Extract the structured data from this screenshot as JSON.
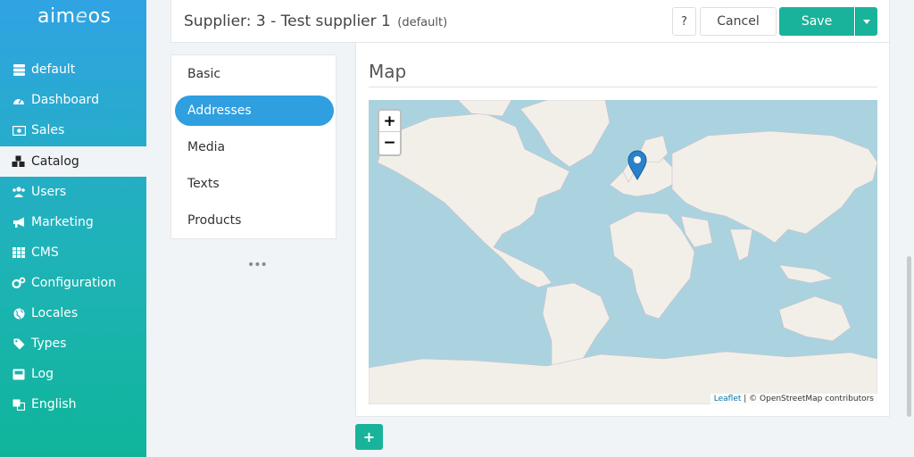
{
  "sidebar": {
    "logo": {
      "prefix": "aim",
      "accent": "e",
      "suffix": "os"
    },
    "items": [
      {
        "label": "default",
        "icon": "database-icon"
      },
      {
        "label": "Dashboard",
        "icon": "gauge-icon"
      },
      {
        "label": "Sales",
        "icon": "money-icon"
      },
      {
        "label": "Catalog",
        "icon": "cubes-icon",
        "active": true
      },
      {
        "label": "Users",
        "icon": "users-icon"
      },
      {
        "label": "Marketing",
        "icon": "bullhorn-icon"
      },
      {
        "label": "CMS",
        "icon": "grid-icon"
      },
      {
        "label": "Configuration",
        "icon": "cogs-icon"
      },
      {
        "label": "Locales",
        "icon": "globe-icon"
      },
      {
        "label": "Types",
        "icon": "tag-icon"
      },
      {
        "label": "Log",
        "icon": "inbox-icon"
      },
      {
        "label": "English",
        "icon": "language-icon"
      }
    ]
  },
  "header": {
    "title": "Supplier: 3 - Test supplier 1",
    "subtitle": "(default)",
    "help_label": "?",
    "cancel_label": "Cancel",
    "save_label": "Save"
  },
  "tabs": [
    {
      "label": "Basic"
    },
    {
      "label": "Addresses",
      "active": true
    },
    {
      "label": "Media"
    },
    {
      "label": "Texts"
    },
    {
      "label": "Products"
    }
  ],
  "more_label": "•••",
  "map": {
    "title": "Map",
    "zoom_in": "+",
    "zoom_out": "−",
    "attribution_link": "Leaflet",
    "attribution_text": " | © OpenStreetMap contributors"
  },
  "add_label": "+",
  "colors": {
    "accent": "#19b39b",
    "active_tab": "#2f9fe0",
    "water": "#aad3df",
    "land": "#f2efe9"
  }
}
